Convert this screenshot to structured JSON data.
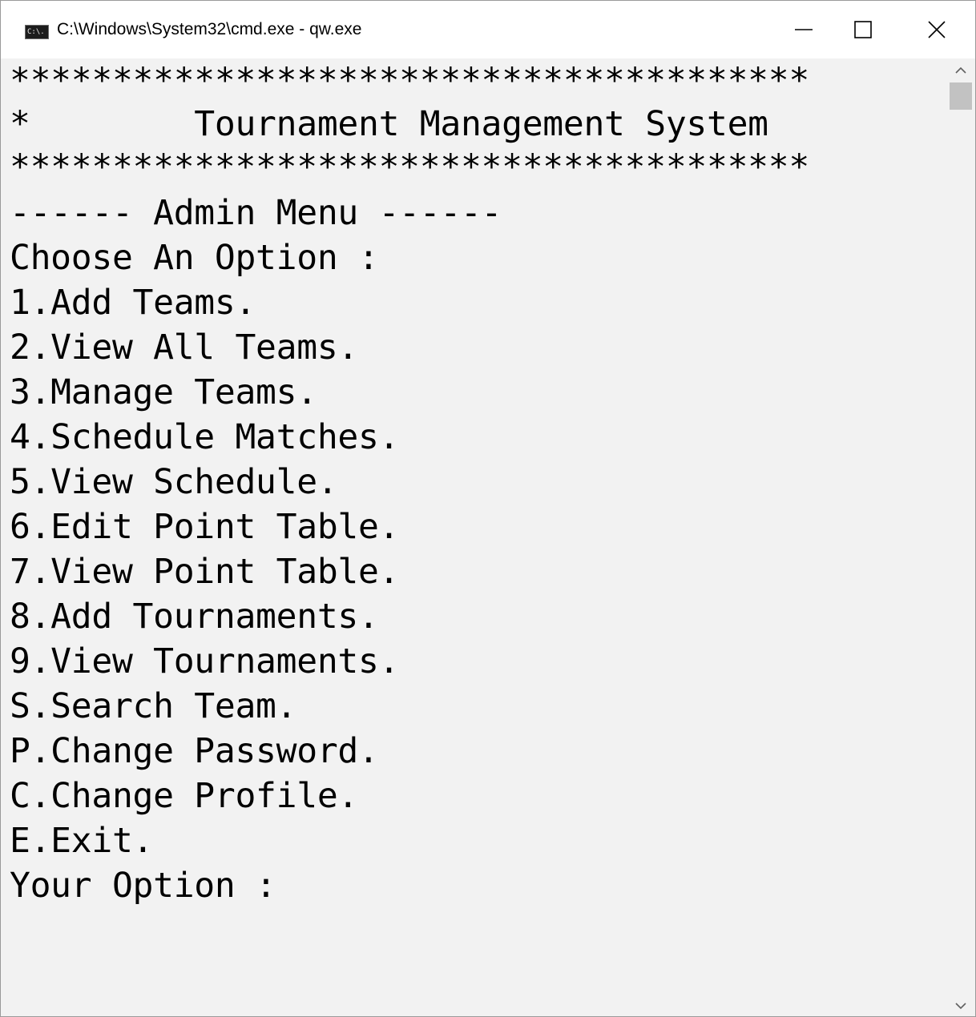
{
  "window": {
    "title": "C:\\Windows\\System32\\cmd.exe - qw.exe",
    "icon": "cmd-console-icon",
    "icon_text": "C:\\."
  },
  "console": {
    "lines": [
      "***************************************",
      "*        Tournament Management System         *",
      "***************************************",
      "------ Admin Menu ------",
      "Choose An Option :",
      "1.Add Teams.",
      "2.View All Teams.",
      "3.Manage Teams.",
      "4.Schedule Matches.",
      "5.View Schedule.",
      "6.Edit Point Table.",
      "7.View Point Table.",
      "8.Add Tournaments.",
      "9.View Tournaments.",
      "S.Search Team.",
      "P.Change Password.",
      "C.Change Profile.",
      "E.Exit.",
      "Your Option :"
    ]
  },
  "colors": {
    "console_bg": "#f2f2f2",
    "console_text": "#000000",
    "titlebar_bg": "#ffffff"
  }
}
